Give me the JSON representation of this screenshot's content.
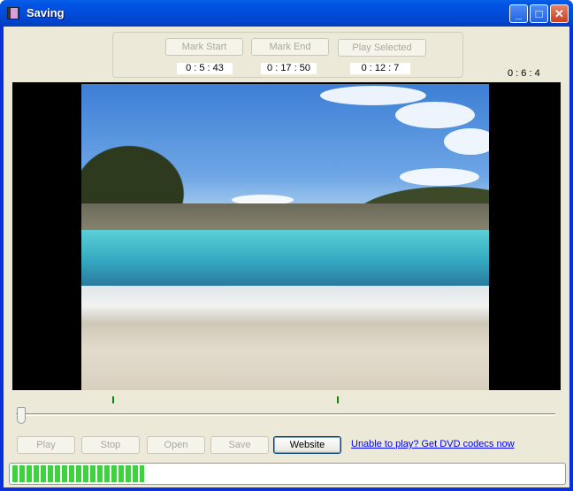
{
  "window": {
    "title": "Saving",
    "app_icon": "film-icon"
  },
  "selection": {
    "mark_start_label": "Mark Start",
    "mark_end_label": "Mark End",
    "play_selected_label": "Play Selected",
    "start_time": "0 : 5 : 43",
    "end_time": "0 : 17 : 50",
    "selected_duration": "0 : 12 : 7"
  },
  "current_time": "0 : 6 : 4",
  "controls": {
    "play_label": "Play",
    "stop_label": "Stop",
    "open_label": "Open",
    "save_label": "Save",
    "website_label": "Website",
    "codec_link": "Unable to play? Get DVD codecs now"
  },
  "progress": {
    "percent": 24,
    "color": "#3ed33e"
  },
  "seek": {
    "position_percent": 0
  }
}
